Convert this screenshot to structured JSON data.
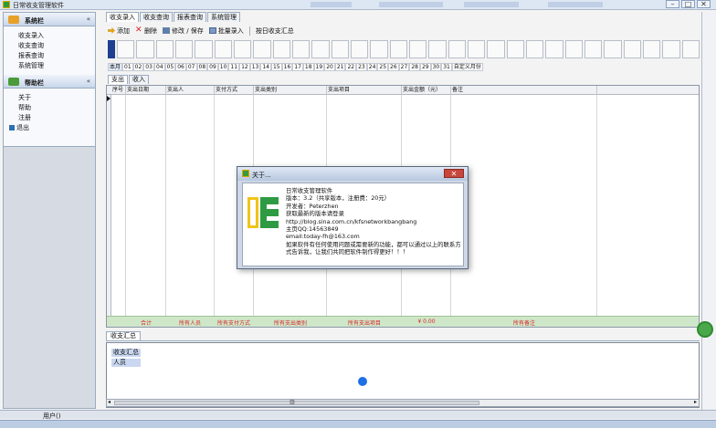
{
  "window": {
    "title": "日常收支管理软件",
    "controls": [
      "–",
      "□",
      "✕"
    ]
  },
  "nav": {
    "system": {
      "title": "系统栏",
      "items": [
        "收支录入",
        "收支查询",
        "报表查询",
        "系统管理"
      ]
    },
    "help": {
      "title": "帮助栏",
      "items": [
        "关于",
        "帮助",
        "注册"
      ],
      "exit": "退出"
    }
  },
  "tabs": [
    "收支录入",
    "收支查询",
    "报表查询",
    "系统管理"
  ],
  "toolbar": {
    "add": "添加",
    "delete": "删除",
    "edit_save": "修改 / 保存",
    "batch_import": "批量录入",
    "summary": "按日收支汇总"
  },
  "days": {
    "this_month": "本月",
    "numbers": [
      "01",
      "02",
      "03",
      "04",
      "05",
      "06",
      "07",
      "08",
      "09",
      "10",
      "11",
      "12",
      "13",
      "14",
      "15",
      "16",
      "17",
      "18",
      "19",
      "20",
      "21",
      "22",
      "23",
      "24",
      "25",
      "26",
      "27",
      "28",
      "29",
      "30",
      "31"
    ],
    "custom": "自定义月份"
  },
  "subtabs": [
    "支出",
    "收入"
  ],
  "grid": {
    "columns": [
      "序号",
      "支出日期",
      "支出人",
      "支付方式",
      "支出类别",
      "支出项目",
      "支出金额（元）",
      "备注"
    ],
    "totals": {
      "label": "合计",
      "person": "所有人员",
      "pay": "所有支付方式",
      "category": "所有支出类别",
      "item": "所有支出项目",
      "amount": "¥ 0.00",
      "note": "所有备注"
    }
  },
  "summary": {
    "tab": "收支汇总",
    "items": [
      "收支汇总",
      "人员"
    ]
  },
  "status": {
    "user": "用户()"
  },
  "about": {
    "title": "关于...",
    "close": "✕",
    "lines": [
      "日常收支管理软件",
      "版本：3.2（共享版本，注册费：20元）",
      "开发者：Peterzhen",
      "获取最新的版本请登录",
      "http://blog.sina.com.cn/kfsnetworkbangbang",
      "主页QQ:14563849",
      "email:today-fh@163.com",
      "如果软件有任何使用问题或需要新的功能，都可以通过以上的联系方",
      "式告诉我，让我们共同把软件制作得更好！！！"
    ]
  },
  "colors": {
    "accent": "#2e9b43",
    "logo_yellow": "#f0c419",
    "totals_bg": "#cfe7c9",
    "totals_text": "#d9262a",
    "dialog_close": "#c8463c"
  }
}
